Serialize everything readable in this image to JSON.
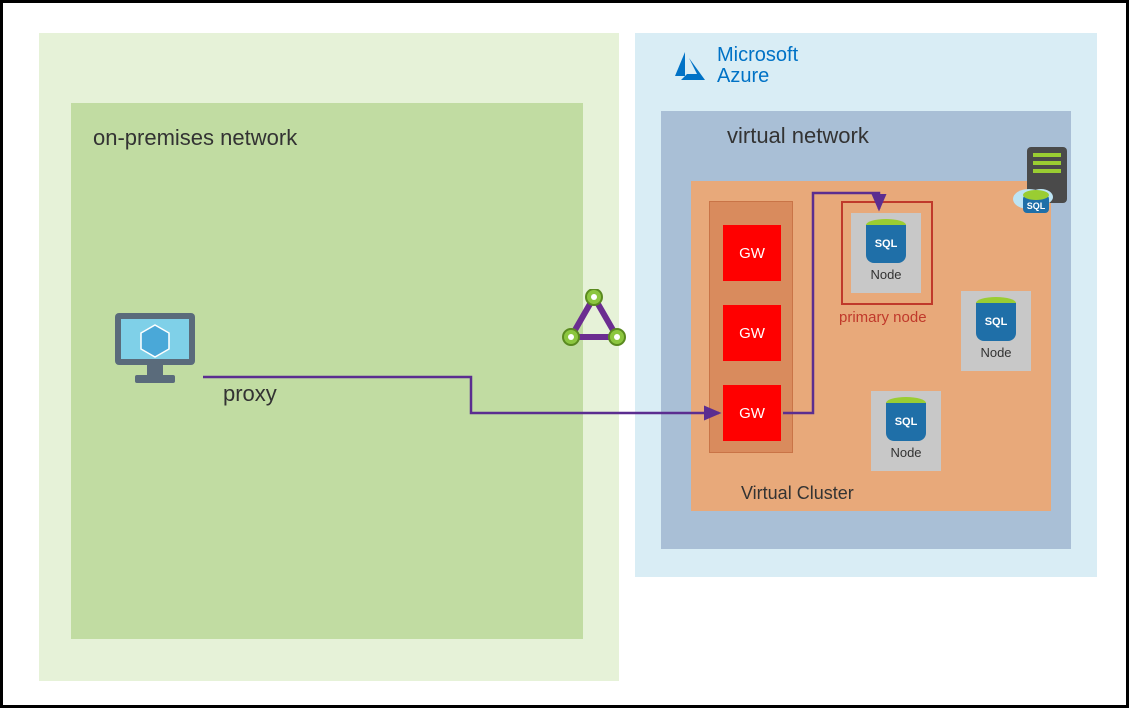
{
  "onprem": {
    "title": "on-premises network"
  },
  "proxy": {
    "label": "proxy"
  },
  "azure": {
    "brand_line1": "Microsoft",
    "brand_line2": "Azure"
  },
  "vnet": {
    "title": "virtual network"
  },
  "vcluster": {
    "title": "Virtual Cluster"
  },
  "gw": {
    "label": "GW"
  },
  "sql": {
    "barrel_label": "SQL",
    "node_label": "Node"
  },
  "primary": {
    "label": "primary node"
  },
  "colors": {
    "onprem_outer": "#e6f2d8",
    "onprem_inner": "#c1dca2",
    "azure_outer": "#d9edf5",
    "vnet": "#a9bfd6",
    "cluster": "#e8a97a",
    "gw": "#ff0000",
    "arrow": "#5b2d90",
    "azure_brand": "#0072c6"
  }
}
